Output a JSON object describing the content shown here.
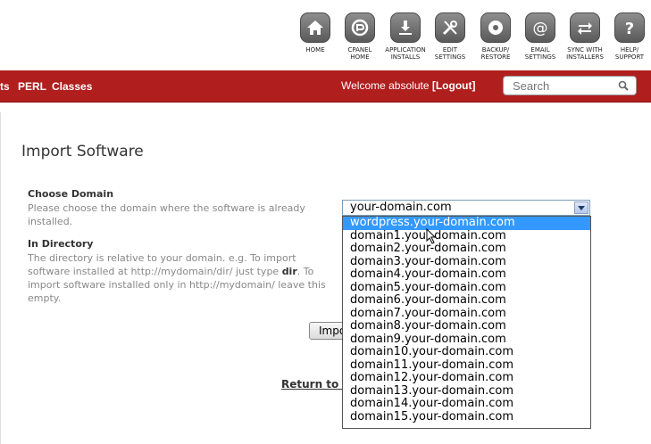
{
  "toolbar": {
    "items": [
      {
        "icon": "home-icon",
        "line1": "HOME",
        "line2": ""
      },
      {
        "icon": "cpanel-icon",
        "line1": "CPANEL",
        "line2": "HOME"
      },
      {
        "icon": "download-icon",
        "line1": "APPLICATION",
        "line2": "INSTALLS"
      },
      {
        "icon": "tools-icon",
        "line1": "EDIT",
        "line2": "SETTINGS"
      },
      {
        "icon": "disc-icon",
        "line1": "BACKUP/",
        "line2": "RESTORE"
      },
      {
        "icon": "at-icon",
        "line1": "EMAIL",
        "line2": "SETTINGS"
      },
      {
        "icon": "sync-icon",
        "line1": "SYNC WITH",
        "line2": "INSTALLERS"
      },
      {
        "icon": "help-icon",
        "line1": "HELP/",
        "line2": "SUPPORT"
      }
    ]
  },
  "nav": {
    "link1": "ts",
    "link2": "PERL",
    "link3": "Classes",
    "welcome_prefix": "Welcome absolute ",
    "logout": "[Logout]",
    "search_placeholder": "Search",
    "bg_color": "#b01e1e"
  },
  "main": {
    "title": "Import Software",
    "choose_domain_label": "Choose Domain",
    "choose_domain_desc": "Please choose the domain where the software is already installed.",
    "directory_label": "In Directory",
    "directory_desc_1": "The directory is relative to your domain. e.g. To import software installed at http://mydomain/dir/ just type ",
    "directory_desc_bold": "dir",
    "directory_desc_2": ". To import software installed only in http://mydomain/ leave this empty.",
    "selected_domain": "your-domain.com",
    "import_button": "Import",
    "return_link": "Return to Overview"
  },
  "dropdown": {
    "options": [
      "wordpress.your-domain.com",
      "domain1.your-domain.com",
      "domain2.your-domain.com",
      "domain3.your-domain.com",
      "domain4.your-domain.com",
      "domain5.your-domain.com",
      "domain6.your-domain.com",
      "domain7.your-domain.com",
      "domain8.your-domain.com",
      "domain9.your-domain.com",
      "domain10.your-domain.com",
      "domain11.your-domain.com",
      "domain12.your-domain.com",
      "domain13.your-domain.com",
      "domain14.your-domain.com",
      "domain15.your-domain.com"
    ],
    "highlighted": "wordpress.your-domain.com",
    "highlight_color": "#3399ff"
  }
}
